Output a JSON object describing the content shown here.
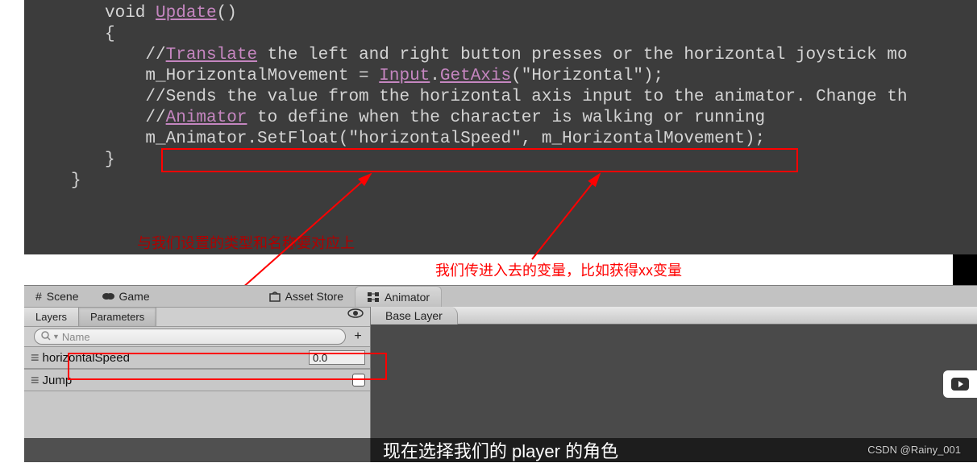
{
  "code": {
    "l1_void": "void ",
    "l1_upd": "Update",
    "l1_paren": "()",
    "l2": "{",
    "l3a": "    //",
    "l3b": "Translate",
    "l3c": " the left and right button presses or the horizontal joystick mo",
    "l4a": "    m_HorizontalMovement = ",
    "l4b": "Input",
    "l4c": ".",
    "l4d": "GetAxis",
    "l4e": "(\"Horizontal\");",
    "l5": "    //Sends the value from the horizontal axis input to the animator. Change th",
    "l6a": "    //",
    "l6b": "Animator",
    "l6c": " to define when the character is walking or running",
    "l7": "    m_Animator.SetFloat(\"horizontalSpeed\", m_HorizontalMovement);",
    "l8": "}",
    "l9": "}"
  },
  "annotations": {
    "left": "与我们设置的类型和名称要对应上",
    "right": "我们传进入去的变量，比如获得xx变量"
  },
  "unity": {
    "tabs": {
      "scene": "Scene",
      "game": "Game",
      "asset": "Asset Store",
      "animator": "Animator"
    },
    "subtabs": {
      "layers": "Layers",
      "params": "Parameters"
    },
    "search_placeholder": "Name",
    "params": [
      {
        "name": "horizontalSpeed",
        "value": "0.0"
      },
      {
        "name": "Jump"
      }
    ],
    "crumb": "Base Layer"
  },
  "watermark": "CSDN @Rainy_001",
  "bottom_text": "现在选择我们的  player  的角色"
}
